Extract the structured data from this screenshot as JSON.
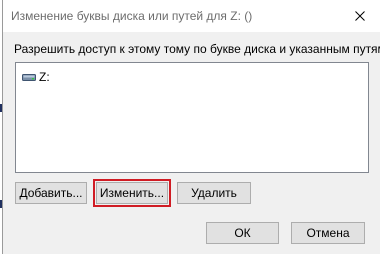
{
  "window": {
    "title": "Изменение буквы диска или путей для Z: ()",
    "close_icon": "close-icon"
  },
  "dialog": {
    "instruction": "Разрешить доступ к этому тому по букве диска и указанным путям.",
    "list": {
      "items": [
        {
          "label": "Z:",
          "icon": "drive-icon"
        }
      ]
    },
    "buttons": {
      "add": "Добавить...",
      "change": "Изменить...",
      "delete": "Удалить",
      "ok": "ОК",
      "cancel": "Отмена"
    }
  },
  "colors": {
    "highlight": "#d01c24",
    "title_text": "#6d6d6d",
    "dialog_bg": "#f0f0f0"
  }
}
